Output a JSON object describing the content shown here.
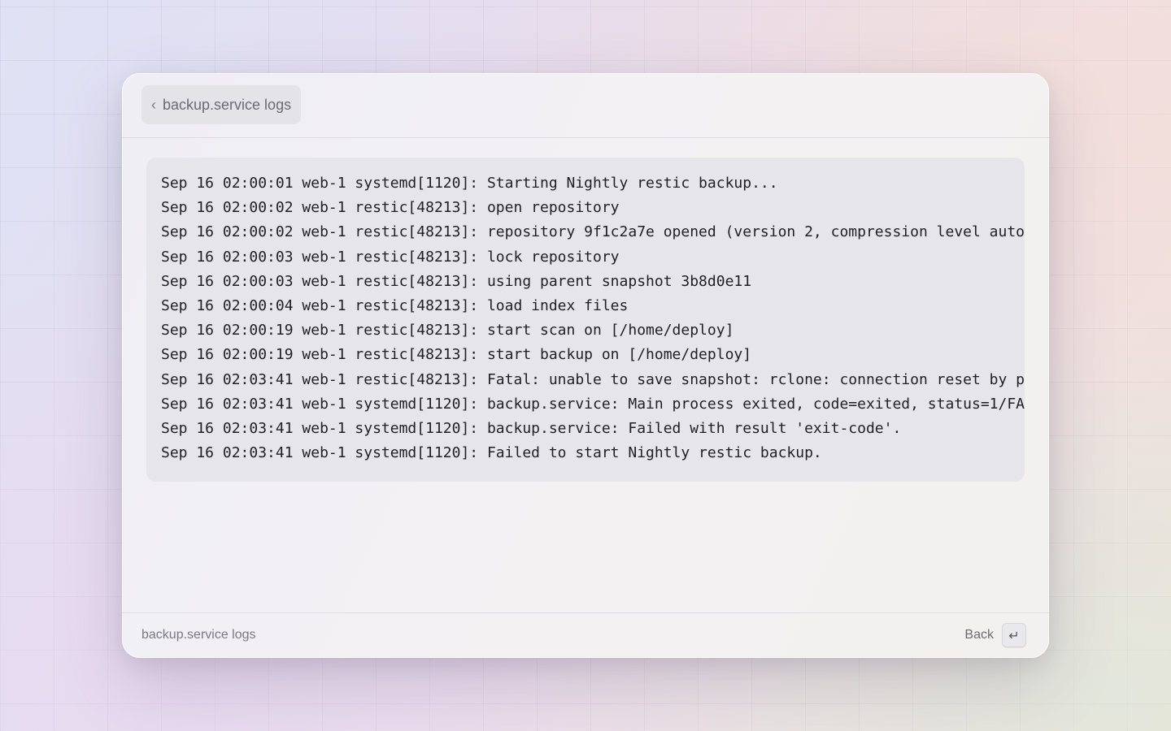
{
  "header": {
    "back_chevron": "‹",
    "back_label": "backup.service logs"
  },
  "log": {
    "lines": [
      "Sep 16 02:00:01 web-1 systemd[1120]: Starting Nightly restic backup...",
      "Sep 16 02:00:02 web-1 restic[48213]: open repository",
      "Sep 16 02:00:02 web-1 restic[48213]: repository 9f1c2a7e opened (version 2, compression level auto",
      "Sep 16 02:00:03 web-1 restic[48213]: lock repository",
      "Sep 16 02:00:03 web-1 restic[48213]: using parent snapshot 3b8d0e11",
      "Sep 16 02:00:04 web-1 restic[48213]: load index files",
      "Sep 16 02:00:19 web-1 restic[48213]: start scan on [/home/deploy]",
      "Sep 16 02:00:19 web-1 restic[48213]: start backup on [/home/deploy]",
      "Sep 16 02:03:41 web-1 restic[48213]: Fatal: unable to save snapshot: rclone: connection reset by p",
      "Sep 16 02:03:41 web-1 systemd[1120]: backup.service: Main process exited, code=exited, status=1/FA",
      "Sep 16 02:03:41 web-1 systemd[1120]: backup.service: Failed with result 'exit-code'.",
      "Sep 16 02:03:41 web-1 systemd[1120]: Failed to start Nightly restic backup."
    ]
  },
  "footer": {
    "title": "backup.service logs",
    "back_label": "Back",
    "back_key": "↵"
  }
}
